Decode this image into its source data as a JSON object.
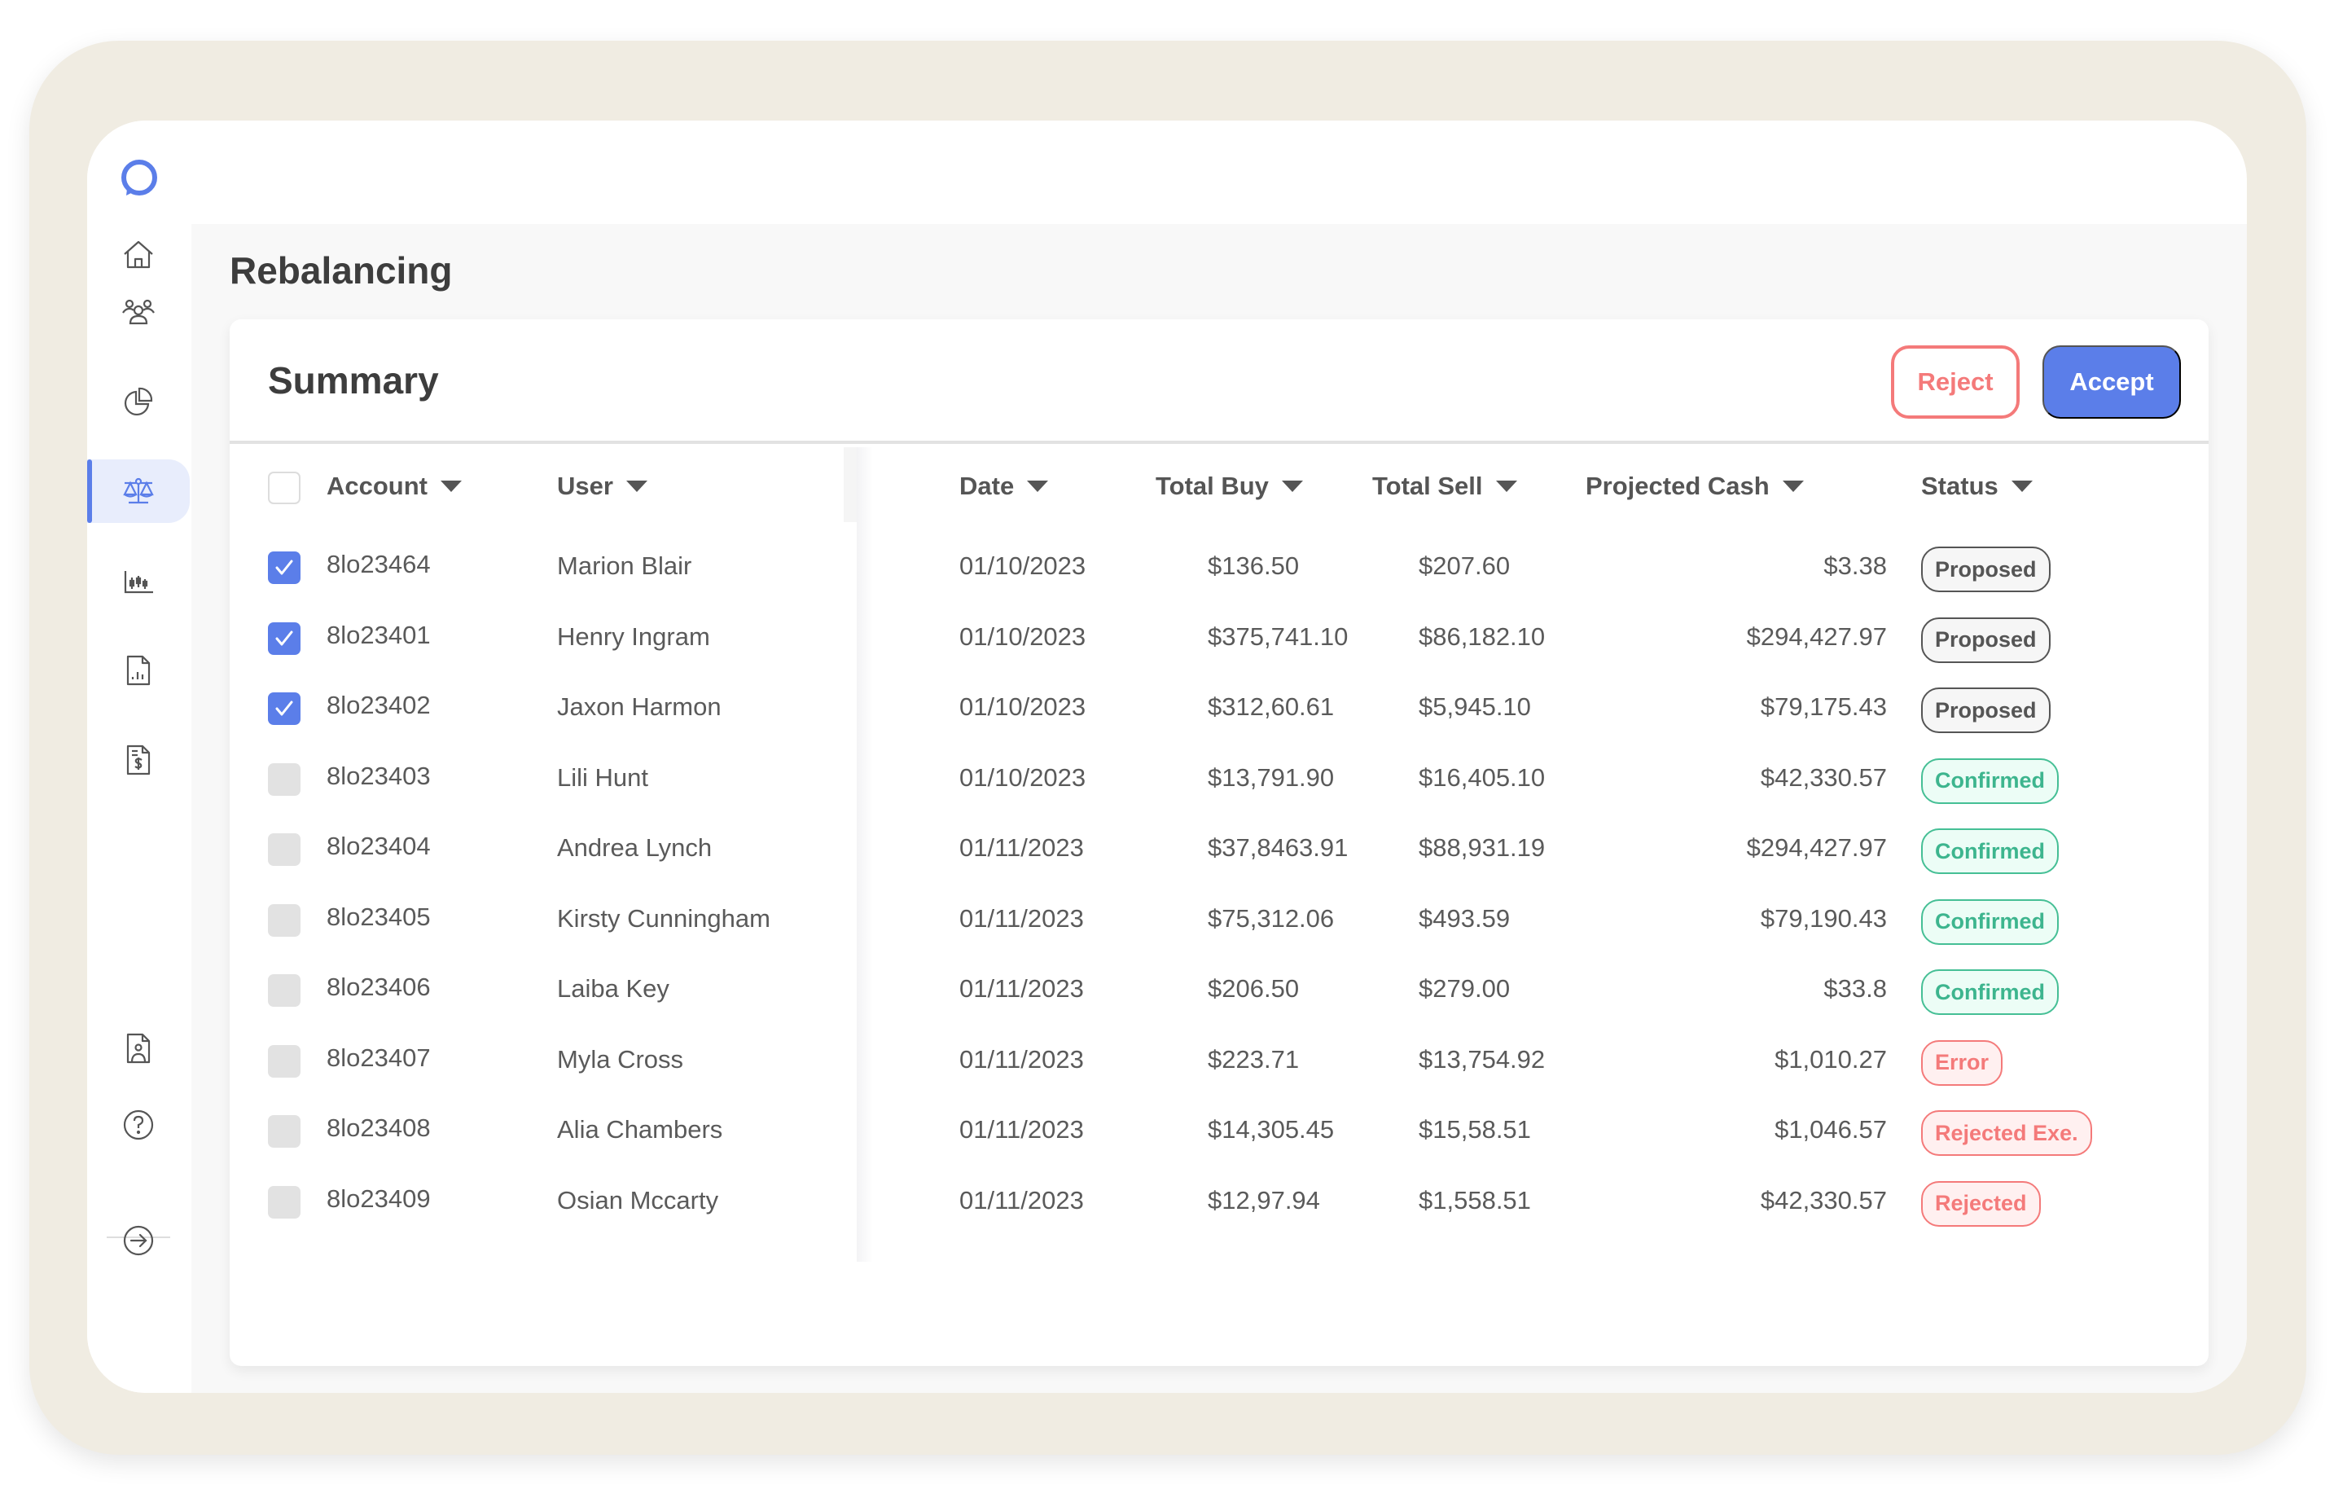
{
  "app": {
    "page_title": "Rebalancing",
    "brand_color": "#5b7ee9"
  },
  "sidebar": {
    "items": [
      {
        "name": "home",
        "icon": "home-icon",
        "active": false
      },
      {
        "name": "clients",
        "icon": "users-icon",
        "active": false
      },
      {
        "name": "portfolio",
        "icon": "pie-chart-icon",
        "active": false
      },
      {
        "name": "rebalancing",
        "icon": "scale-icon",
        "active": true
      },
      {
        "name": "market",
        "icon": "candlestick-icon",
        "active": false
      },
      {
        "name": "reports",
        "icon": "report-chart-icon",
        "active": false
      },
      {
        "name": "billing",
        "icon": "invoice-dollar-icon",
        "active": false
      }
    ],
    "bottom_items": [
      {
        "name": "profile",
        "icon": "user-document-icon"
      },
      {
        "name": "help",
        "icon": "help-circle-icon"
      },
      {
        "name": "logout",
        "icon": "arrow-right-circle-icon"
      }
    ]
  },
  "summary": {
    "title": "Summary",
    "reject_label": "Reject",
    "accept_label": "Accept"
  },
  "table": {
    "columns": {
      "account": "Account",
      "user": "User",
      "date": "Date",
      "total_buy": "Total Buy",
      "total_sell": "Total Sell",
      "projected_cash": "Projected Cash",
      "status": "Status"
    },
    "select_all_checked": false,
    "rows": [
      {
        "checked": true,
        "account": "8lo23464",
        "user": "Marion Blair",
        "date": "01/10/2023",
        "total_buy": "$136.50",
        "total_sell": "$207.60",
        "projected_cash": "$3.38",
        "status": "Proposed",
        "status_kind": "proposed"
      },
      {
        "checked": true,
        "account": "8lo23401",
        "user": "Henry Ingram",
        "date": "01/10/2023",
        "total_buy": "$375,741.10",
        "total_sell": "$86,182.10",
        "projected_cash": "$294,427.97",
        "status": "Proposed",
        "status_kind": "proposed"
      },
      {
        "checked": true,
        "account": "8lo23402",
        "user": "Jaxon Harmon",
        "date": "01/10/2023",
        "total_buy": "$312,60.61",
        "total_sell": "$5,945.10",
        "projected_cash": "$79,175.43",
        "status": "Proposed",
        "status_kind": "proposed"
      },
      {
        "checked": false,
        "account": "8lo23403",
        "user": "Lili Hunt",
        "date": "01/10/2023",
        "total_buy": "$13,791.90",
        "total_sell": "$16,405.10",
        "projected_cash": "$42,330.57",
        "status": "Confirmed",
        "status_kind": "confirmed"
      },
      {
        "checked": false,
        "account": "8lo23404",
        "user": "Andrea Lynch",
        "date": "01/11/2023",
        "total_buy": "$37,8463.91",
        "total_sell": "$88,931.19",
        "projected_cash": "$294,427.97",
        "status": "Confirmed",
        "status_kind": "confirmed"
      },
      {
        "checked": false,
        "account": "8lo23405",
        "user": "Kirsty Cunningham",
        "date": "01/11/2023",
        "total_buy": "$75,312.06",
        "total_sell": "$493.59",
        "projected_cash": "$79,190.43",
        "status": "Confirmed",
        "status_kind": "confirmed"
      },
      {
        "checked": false,
        "account": "8lo23406",
        "user": "Laiba Key",
        "date": "01/11/2023",
        "total_buy": "$206.50",
        "total_sell": "$279.00",
        "projected_cash": "$33.8",
        "status": "Confirmed",
        "status_kind": "confirmed"
      },
      {
        "checked": false,
        "account": "8lo23407",
        "user": "Myla Cross",
        "date": "01/11/2023",
        "total_buy": "$223.71",
        "total_sell": "$13,754.92",
        "projected_cash": "$1,010.27",
        "status": "Error",
        "status_kind": "error"
      },
      {
        "checked": false,
        "account": "8lo23408",
        "user": "Alia Chambers",
        "date": "01/11/2023",
        "total_buy": "$14,305.45",
        "total_sell": "$15,58.51",
        "projected_cash": "$1,046.57",
        "status": "Rejected Exe.",
        "status_kind": "error"
      },
      {
        "checked": false,
        "account": "8lo23409",
        "user": "Osian Mccarty",
        "date": "01/11/2023",
        "total_buy": "$12,97.94",
        "total_sell": "$1,558.51",
        "projected_cash": "$42,330.57",
        "status": "Rejected",
        "status_kind": "error"
      }
    ]
  },
  "status_colors": {
    "proposed": "#555555",
    "confirmed": "#3db58e",
    "error": "#f47a7a"
  }
}
